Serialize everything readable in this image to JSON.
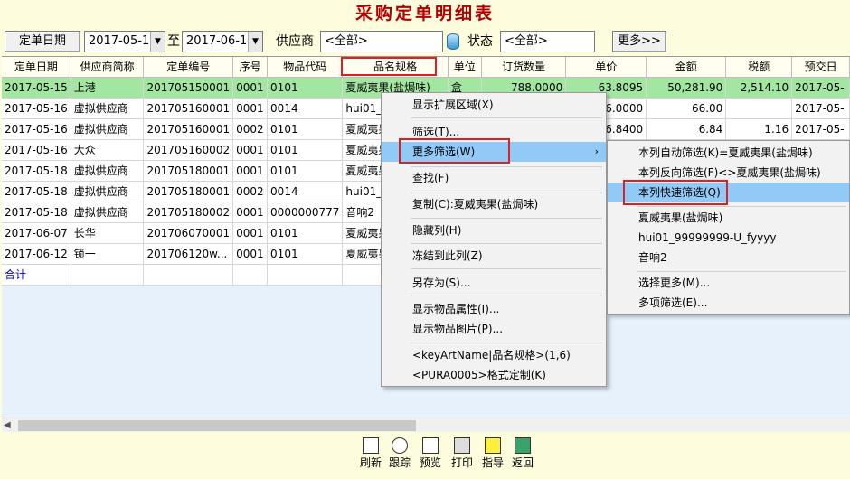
{
  "window": {
    "title": "采购定单明细表"
  },
  "filter": {
    "date_button": "定单日期",
    "date_from": "2017-05-15",
    "to_label": "至",
    "date_to": "2017-06-14",
    "supplier_label": "供应商",
    "supplier_value": "<全部>",
    "status_label": "状态",
    "status_value": "<全部>",
    "more_button": "更多>>"
  },
  "table": {
    "columns": [
      "定单日期",
      "供应商简称",
      "定单编号",
      "序号",
      "物品代码",
      "品名规格",
      "单位",
      "订货数量",
      "单价",
      "金额",
      "税额",
      "预交日"
    ],
    "rows": [
      [
        "2017-05-15",
        "上港",
        "201705150001",
        "0001",
        "0101",
        "夏威夷果(盐焗味)",
        "盒",
        "788.0000",
        "63.8095",
        "50,281.90",
        "2,514.10",
        "2017-05-"
      ],
      [
        "2017-05-16",
        "虚拟供应商",
        "201705160001",
        "0001",
        "0014",
        "hui01_9",
        "",
        "",
        "66.0000",
        "66.00",
        "",
        "2017-05-"
      ],
      [
        "2017-05-16",
        "虚拟供应商",
        "201705160001",
        "0002",
        "0101",
        "夏威夷果",
        "",
        "",
        "6.8400",
        "6.84",
        "1.16",
        "2017-05-"
      ],
      [
        "2017-05-16",
        "大众",
        "201705160002",
        "0001",
        "0101",
        "夏威夷果",
        "",
        "",
        "",
        "",
        "",
        ""
      ],
      [
        "2017-05-18",
        "虚拟供应商",
        "201705180001",
        "0001",
        "0101",
        "夏威夷果",
        "",
        "",
        "",
        "",
        "",
        ""
      ],
      [
        "2017-05-18",
        "虚拟供应商",
        "201705180001",
        "0002",
        "0014",
        "hui01_9",
        "",
        "",
        "",
        "",
        "",
        ""
      ],
      [
        "2017-05-18",
        "虚拟供应商",
        "201705180002",
        "0001",
        "0000000777",
        "音响2",
        "",
        "",
        "",
        "",
        "",
        ""
      ],
      [
        "2017-06-07",
        "长华",
        "201706070001",
        "0001",
        "0101",
        "夏威夷果",
        "",
        "",
        "",
        "",
        "",
        ""
      ],
      [
        "2017-06-12",
        "锁一",
        "201706120w...",
        "0001",
        "0101",
        "夏威夷果",
        "",
        "",
        "",
        "",
        "",
        ""
      ]
    ],
    "total_label": "合计"
  },
  "context_menu": {
    "items": [
      "显示扩展区域(X)",
      "筛选(T)...",
      "更多筛选(W)",
      "查找(F)",
      "复制(C):夏威夷果(盐焗味)",
      "隐藏列(H)",
      "冻结到此列(Z)",
      "另存为(S)...",
      "显示物品属性(I)...",
      "显示物品图片(P)...",
      "<keyArtName|品名规格>(1,6)",
      "<PURA0005>格式定制(K)"
    ],
    "submenu_marker": "›"
  },
  "submenu": {
    "items": [
      "本列自动筛选(K)=夏威夷果(盐焗味)",
      "本列反向筛选(F)<>夏威夷果(盐焗味)",
      "本列快速筛选(Q)",
      "夏威夷果(盐焗味)",
      "hui01_99999999-U_fyyyy",
      "音响2",
      "选择更多(M)...",
      "多项筛选(E)..."
    ]
  },
  "toolbar": {
    "buttons": [
      {
        "label": "刷新",
        "icon": "refresh-icon"
      },
      {
        "label": "跟踪",
        "icon": "track-icon"
      },
      {
        "label": "预览",
        "icon": "preview-icon"
      },
      {
        "label": "打印",
        "icon": "print-icon"
      },
      {
        "label": "指导",
        "icon": "help-icon"
      },
      {
        "label": "返回",
        "icon": "exit-icon"
      }
    ]
  },
  "colors": {
    "title": "#b00000",
    "selected_row": "#a3e6a1",
    "menu_hover": "#91c9f7",
    "highlight_box": "#e02020",
    "background": "#fdfcdd"
  }
}
